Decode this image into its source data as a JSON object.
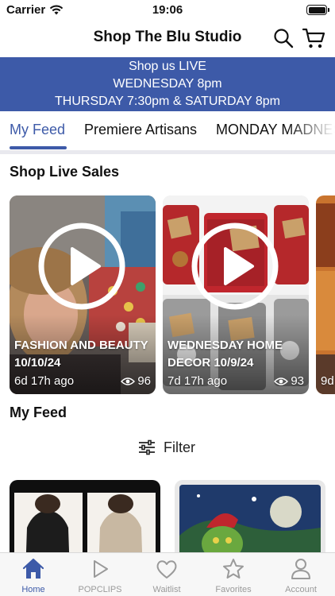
{
  "status_bar": {
    "carrier": "Carrier",
    "time": "19:06"
  },
  "header": {
    "title": "Shop The Blu Studio",
    "search_icon": "search-icon",
    "cart_icon": "cart-icon"
  },
  "banner": {
    "line1": "Shop us LIVE",
    "line2": "WEDNESDAY 8pm",
    "line3": "THURSDAY 7:30pm & SATURDAY 8pm",
    "background": "#3d5aa8"
  },
  "tabs": [
    {
      "label": "My Feed",
      "active": true
    },
    {
      "label": "Premiere Artisans",
      "active": false
    },
    {
      "label": "MONDAY MADNESS",
      "active": false
    }
  ],
  "live_sales": {
    "title": "Shop Live Sales",
    "cards": [
      {
        "title": "FASHION AND BEAUTY 10/10/24",
        "ago": "6d 17h ago",
        "views": "96"
      },
      {
        "title": "WEDNESDAY HOME DECOR 10/9/24",
        "ago": "7d 17h ago",
        "views": "93"
      },
      {
        "ago": "9d"
      }
    ]
  },
  "feed": {
    "title": "My Feed",
    "filter_label": "Filter"
  },
  "bottom_tabs": [
    {
      "label": "Home",
      "icon": "home-icon",
      "active": true
    },
    {
      "label": "POPCLIPS",
      "icon": "play-icon",
      "active": false
    },
    {
      "label": "Waitlist",
      "icon": "heart-icon",
      "active": false
    },
    {
      "label": "Favorites",
      "icon": "star-icon",
      "active": false
    },
    {
      "label": "Account",
      "icon": "person-icon",
      "active": false
    }
  ],
  "colors": {
    "accent": "#3d5aa8",
    "inactive": "#9a9a9a"
  }
}
